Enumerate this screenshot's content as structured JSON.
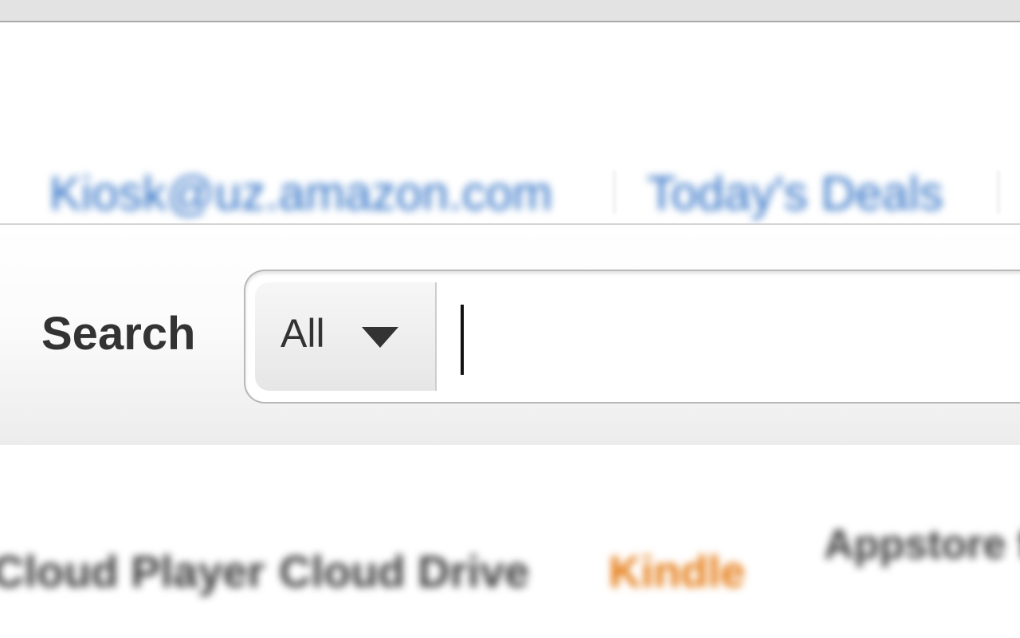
{
  "top_links": [
    {
      "label": "Kiosk@uz.amazon.com"
    },
    {
      "label": "Today's Deals"
    }
  ],
  "search": {
    "label": "Search",
    "category": "All",
    "value": "",
    "placeholder": ""
  },
  "nav": {
    "items": [
      {
        "label": "Cloud Player"
      },
      {
        "label": "Cloud Drive"
      },
      {
        "label": "Kindle"
      },
      {
        "label": "Appstore for Android"
      }
    ]
  },
  "colors": {
    "link": "#2c6ec4",
    "accent": "#e47911",
    "text": "#333333"
  }
}
